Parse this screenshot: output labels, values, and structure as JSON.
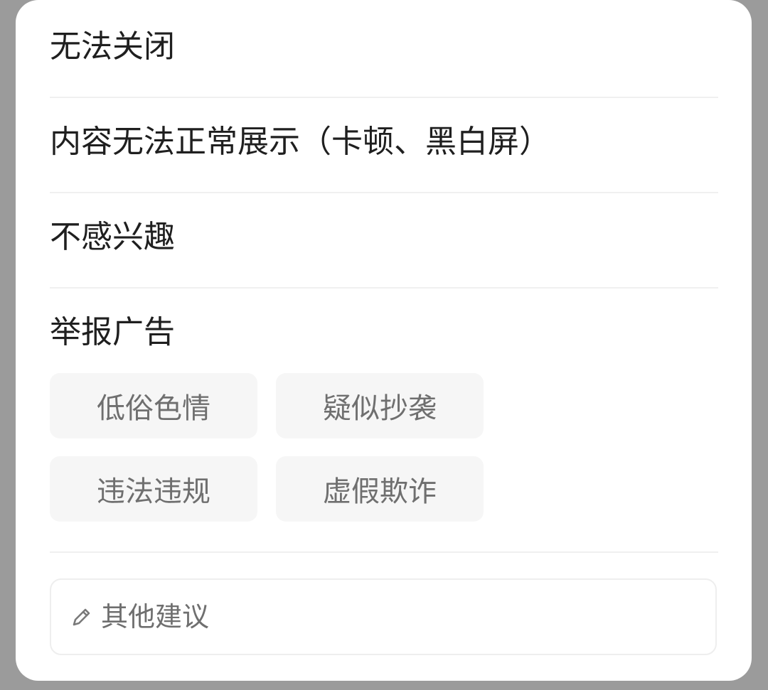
{
  "menu": {
    "items": [
      "无法关闭",
      "内容无法正常展示（卡顿、黑白屏）",
      "不感兴趣"
    ],
    "report": {
      "title": "举报广告",
      "options": [
        "低俗色情",
        "疑似抄袭",
        "违法违规",
        "虚假欺诈"
      ]
    },
    "suggestion": {
      "placeholder": "其他建议",
      "icon": "pencil-icon"
    }
  },
  "colors": {
    "overlay": "#9b9b9b",
    "sheet": "#ffffff",
    "text_primary": "#1f1f1f",
    "text_secondary": "#6f6f6f",
    "tag_bg": "#f6f6f6",
    "divider": "#f0f0f0"
  }
}
